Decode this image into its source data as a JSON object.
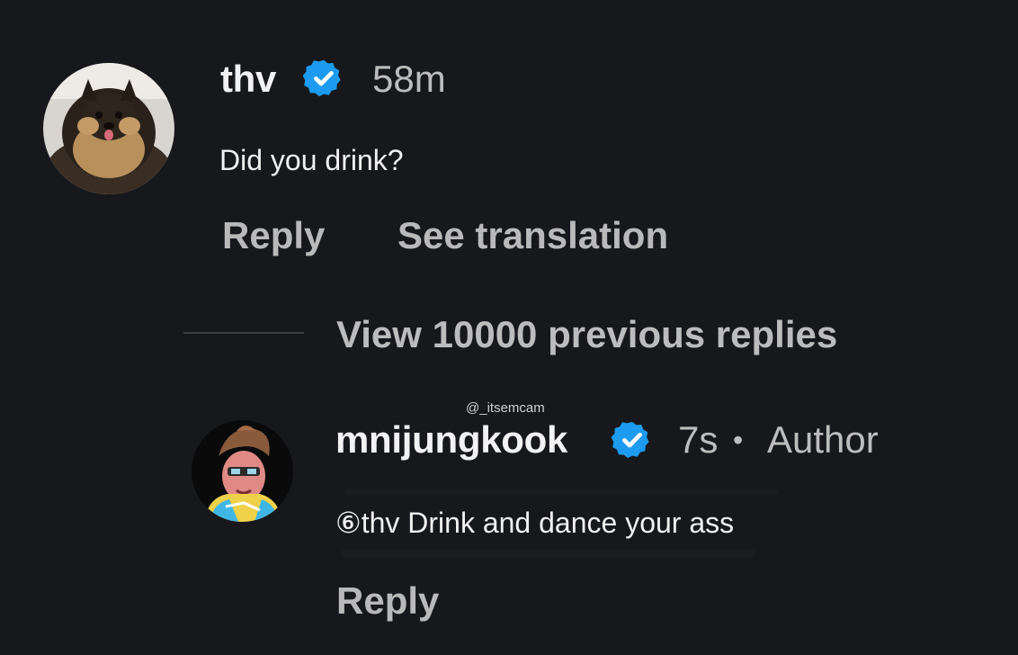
{
  "parent_comment": {
    "username": "thv",
    "verified": true,
    "time": "58m",
    "text": "Did you drink?",
    "reply_label": "Reply",
    "translate_label": "See translation",
    "avatar_icon": "dog-avatar-icon"
  },
  "thread": {
    "view_previous_label": "View 10000 previous replies"
  },
  "watermark": "@_itsemcam",
  "reply_comment": {
    "username": "mnijungkook",
    "verified": true,
    "time": "7s",
    "separator": "•",
    "role": "Author",
    "text": "⑥thv Drink and dance your ass",
    "reply_label": "Reply",
    "avatar_icon": "cartoon-character-avatar-icon"
  },
  "colors": {
    "background": "#17181c",
    "verified_blue": "#1d9bf0",
    "secondary_text": "#b9b9b9"
  }
}
